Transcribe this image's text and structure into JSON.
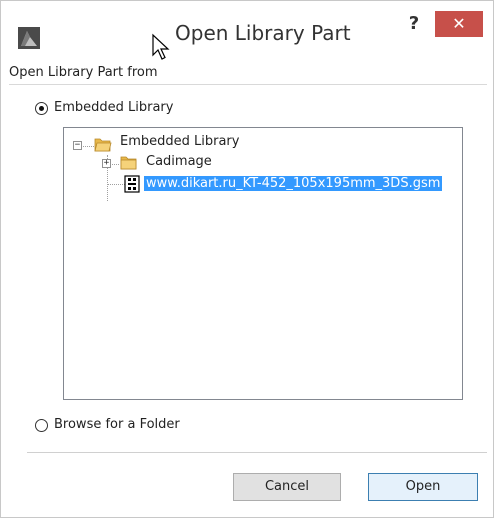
{
  "window": {
    "title": "Open Library Part",
    "help_label": "?",
    "close_label": "✕"
  },
  "section": {
    "label": "Open Library Part from"
  },
  "options": {
    "embedded_label": "Embedded Library",
    "embedded_selected": true,
    "browse_label": "Browse for a Folder",
    "browse_selected": false
  },
  "tree": {
    "root": {
      "label": "Embedded Library",
      "expander": "−"
    },
    "children": [
      {
        "label": "Cadimage",
        "expander": "+"
      },
      {
        "label": "www.dikart.ru_KT-452_105x195mm_3DS.gsm",
        "selected": true
      }
    ]
  },
  "buttons": {
    "cancel_label": "Cancel",
    "open_label": "Open"
  },
  "colors": {
    "selection": "#3399ff",
    "close_button": "#c7504a",
    "folder": "#e8b84a"
  }
}
